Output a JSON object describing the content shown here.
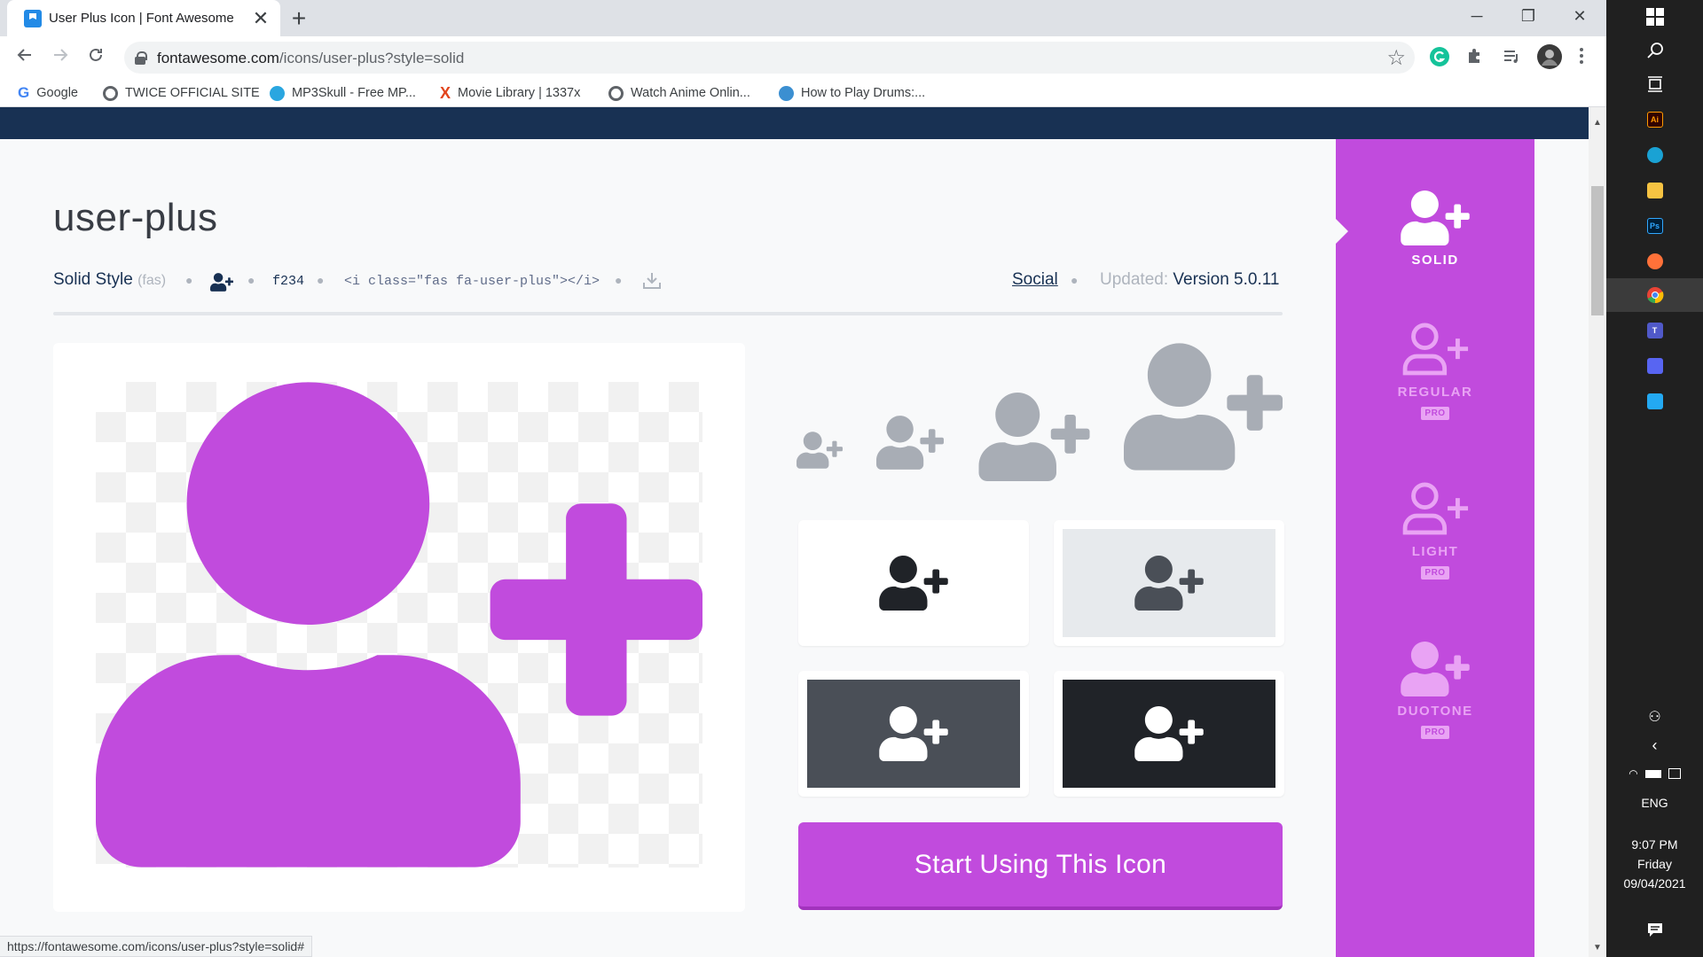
{
  "browser": {
    "tab_title": "User Plus Icon | Font Awesome",
    "tab_close": "✕",
    "new_tab": "+",
    "window": {
      "minimize": "─",
      "maximize": "❐",
      "close": "✕"
    },
    "url_host": "fontawesome.com",
    "url_path": "/icons/user-plus?style=solid",
    "bookmarks": [
      {
        "label": "Google",
        "color": "#4285f4"
      },
      {
        "label": "TWICE OFFICIAL SITE",
        "color": "#5f6368"
      },
      {
        "label": "MP3Skull - Free MP...",
        "color": "#2aa6e0"
      },
      {
        "label": "Movie Library | 1337x",
        "color": "#e2441c"
      },
      {
        "label": "Watch Anime Onlin...",
        "color": "#5f6368"
      },
      {
        "label": "How to Play Drums:...",
        "color": "#3b8fd1"
      }
    ],
    "status_url": "https://fontawesome.com/icons/user-plus?style=solid#"
  },
  "icon": {
    "name": "user-plus",
    "style_label": "Solid Style",
    "style_prefix": "(fas)",
    "unicode": "f234",
    "code_snippet": "<i class=\"fas fa-user-plus\"></i>",
    "category": "Social",
    "updated_label": "Updated:",
    "version": "Version 5.0.11",
    "cta_label": "Start Using This Icon"
  },
  "styles": [
    {
      "label": "SOLID",
      "pro": false,
      "active": true
    },
    {
      "label": "REGULAR",
      "pro": true,
      "active": false
    },
    {
      "label": "LIGHT",
      "pro": true,
      "active": false
    },
    {
      "label": "DUOTONE",
      "pro": true,
      "active": false
    }
  ],
  "pro_badge": "PRO",
  "colors": {
    "brand_purple": "#c14bdd",
    "navy": "#183153",
    "icon_gray": "#a8adb5"
  },
  "taskbar": {
    "language": "ENG",
    "time": "9:07 PM",
    "day": "Friday",
    "date": "09/04/2021"
  }
}
